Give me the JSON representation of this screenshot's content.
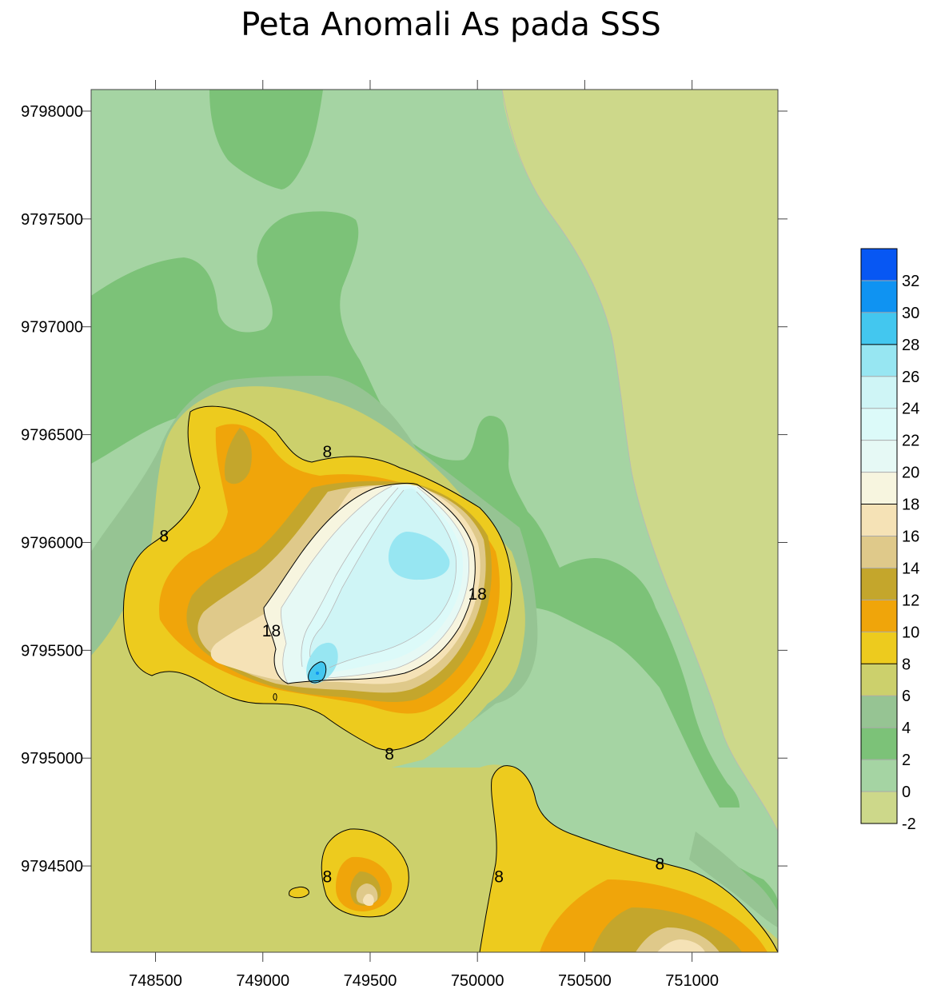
{
  "chart_data": {
    "type": "contour",
    "title": "Peta Anomali As pada SSS",
    "xlabel": "",
    "ylabel": "",
    "xlim": [
      748200,
      751400
    ],
    "ylim": [
      9794100,
      9798100
    ],
    "x_ticks": [
      748500,
      749000,
      749500,
      750000,
      750500,
      751000
    ],
    "y_ticks": [
      9794500,
      9795000,
      9795500,
      9796000,
      9796500,
      9797000,
      9797500,
      9798000
    ],
    "x_tick_labels": [
      "748500",
      "749000",
      "749500",
      "750000",
      "750500",
      "751000"
    ],
    "y_tick_labels": [
      "9794500",
      "9795000",
      "9795500",
      "9796000",
      "9796500",
      "9797000",
      "9797500",
      "9798000"
    ],
    "colorbar": {
      "levels": [
        -2,
        0,
        2,
        4,
        6,
        8,
        10,
        12,
        14,
        16,
        18,
        20,
        22,
        24,
        26,
        28,
        30,
        32,
        34
      ],
      "labels": [
        "-2",
        "0",
        "2",
        "4",
        "6",
        "8",
        "10",
        "12",
        "14",
        "16",
        "18",
        "20",
        "22",
        "24",
        "26",
        "28",
        "30",
        "32"
      ],
      "colors": [
        "#cdd88a",
        "#a5d4a3",
        "#7cc278",
        "#96c493",
        "#ccd06c",
        "#edcb1e",
        "#f0a50a",
        "#c4a62c",
        "#dfc98a",
        "#f5e2b6",
        "#f7f5df",
        "#e6f9f5",
        "#dcfaf9",
        "#cff5f6",
        "#97e6f2",
        "#43c7ef",
        "#0f93f2",
        "#0757f3"
      ],
      "contour_levels_drawn": [
        8,
        18,
        28
      ]
    },
    "contour_labels": [
      {
        "text": "8",
        "x": 749300,
        "y": 9796420
      },
      {
        "text": "8",
        "x": 748540,
        "y": 9796030
      },
      {
        "text": "8",
        "x": 749590,
        "y": 9795020
      },
      {
        "text": "8",
        "x": 749300,
        "y": 9794450
      },
      {
        "text": "8",
        "x": 750100,
        "y": 9794450
      },
      {
        "text": "8",
        "x": 750850,
        "y": 9794510
      },
      {
        "text": "18",
        "x": 750000,
        "y": 9795760
      },
      {
        "text": "18",
        "x": 749040,
        "y": 9795590
      }
    ]
  }
}
